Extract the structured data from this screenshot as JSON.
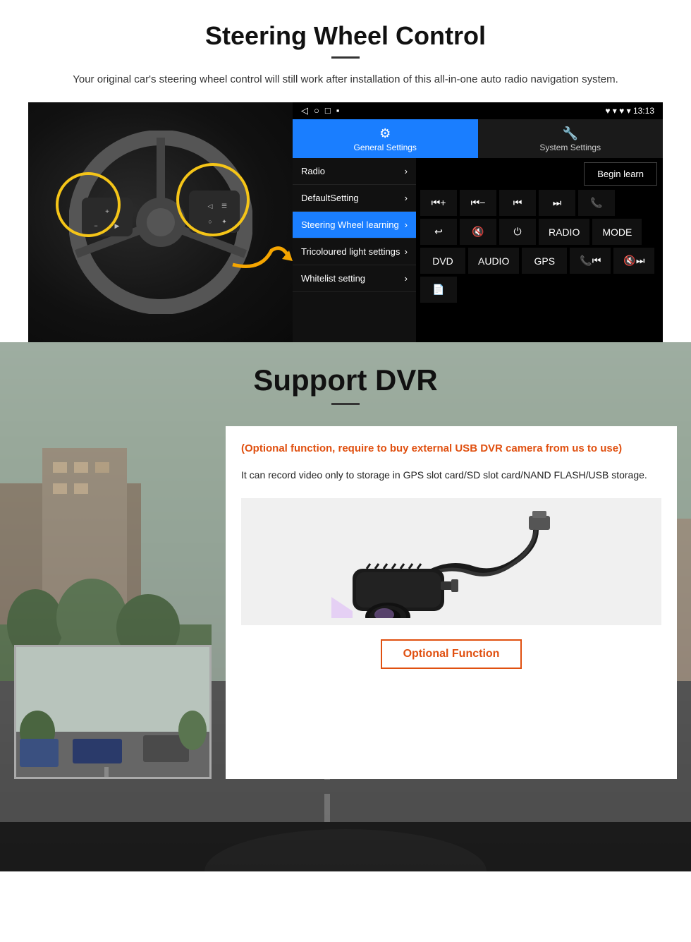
{
  "steering": {
    "title": "Steering Wheel Control",
    "subtitle": "Your original car's steering wheel control will still work after installation of this all-in-one auto radio navigation system.",
    "statusbar": {
      "left": [
        "◁",
        "○",
        "□",
        "▪"
      ],
      "right": "♥ ▾ 13:13"
    },
    "tabs": [
      {
        "icon": "⚙",
        "label": "General Settings",
        "active": true
      },
      {
        "icon": "🔧",
        "label": "System Settings",
        "active": false
      }
    ],
    "menu_items": [
      {
        "label": "Radio",
        "active": false
      },
      {
        "label": "DefaultSetting",
        "active": false
      },
      {
        "label": "Steering Wheel learning",
        "active": true
      },
      {
        "label": "Tricoloured light settings",
        "active": false
      },
      {
        "label": "Whitelist setting",
        "active": false
      }
    ],
    "begin_learn": "Begin learn",
    "control_buttons_row1": [
      "⏮+",
      "⏮-",
      "⏮",
      "⏭",
      "📞"
    ],
    "control_buttons_row2": [
      "↩",
      "🔇",
      "⏻",
      "RADIO",
      "MODE"
    ],
    "control_buttons_row3": [
      "DVD",
      "AUDIO",
      "GPS",
      "📞⏮",
      "🔇⏭"
    ],
    "control_buttons_row4": [
      "📄"
    ]
  },
  "dvr": {
    "title": "Support DVR",
    "optional_text": "(Optional function, require to buy external USB DVR camera from us to use)",
    "desc_text": "It can record video only to storage in GPS slot card/SD slot card/NAND FLASH/USB storage.",
    "optional_fn_label": "Optional Function"
  }
}
